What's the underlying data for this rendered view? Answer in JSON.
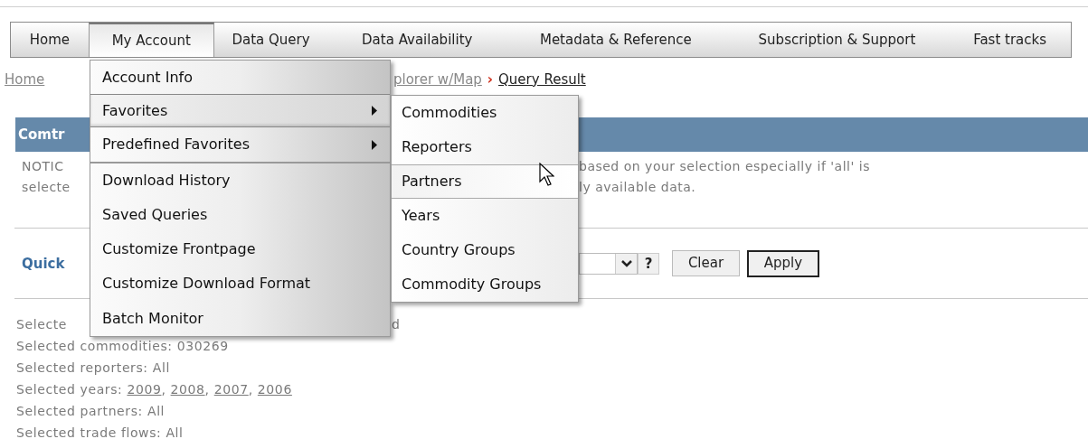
{
  "nav": [
    {
      "label": "Home",
      "selected": false
    },
    {
      "label": "My Account",
      "selected": true
    },
    {
      "label": "Data Query",
      "selected": false
    },
    {
      "label": "Data Availability",
      "selected": false
    },
    {
      "label": "Metadata & Reference",
      "selected": false
    },
    {
      "label": "Subscription & Support",
      "selected": false
    },
    {
      "label": "Fast tracks",
      "selected": false
    }
  ],
  "breadcrumb": [
    {
      "kind": "link",
      "text": "Home"
    },
    {
      "kind": "link",
      "text": "plorer w/Map"
    },
    {
      "kind": "separator",
      "text": "›"
    },
    {
      "kind": "link",
      "text": "Query Result"
    }
  ],
  "section_header": "Comtr",
  "notice": [
    {
      "left": "NOTIC",
      "right": "based on your selection especially if 'all' is"
    },
    {
      "left": "selecte",
      "right": "ly available data."
    }
  ],
  "quick_filter": {
    "label": "Quick",
    "help": "?",
    "buttons": [
      {
        "label": "Clear",
        "default": false
      },
      {
        "label": "Apply",
        "default": true
      }
    ]
  },
  "selections_first": [
    "Selecte",
    "d"
  ],
  "selections": [
    [
      {
        "text": "Selected commodities: 030269"
      }
    ],
    [
      {
        "text": "Selected reporters: All"
      }
    ],
    [
      {
        "text": "Selected years: "
      },
      {
        "text": "2009",
        "link": true
      },
      {
        "text": ", "
      },
      {
        "text": "2008",
        "link": true
      },
      {
        "text": ", "
      },
      {
        "text": "2007",
        "link": true
      },
      {
        "text": ", "
      },
      {
        "text": "2006",
        "link": true
      }
    ],
    [
      {
        "text": "Selected partners: All"
      }
    ],
    [
      {
        "text": "Selected trade flows: All"
      }
    ]
  ],
  "menu": [
    {
      "label": "Account Info",
      "has_submenu": false,
      "selected": false
    },
    {
      "label": "Favorites",
      "has_submenu": true,
      "selected": true
    },
    {
      "label": "Predefined Favorites",
      "has_submenu": true,
      "selected": false
    },
    {
      "label": "Download History",
      "has_submenu": false,
      "selected": false
    },
    {
      "label": "Saved Queries",
      "has_submenu": false,
      "selected": false
    },
    {
      "label": "Customize Frontpage",
      "has_submenu": false,
      "selected": false
    },
    {
      "label": "Customize Download Format",
      "has_submenu": false,
      "selected": false
    },
    {
      "label": "Batch Monitor",
      "has_submenu": false,
      "selected": false
    }
  ],
  "submenu": [
    {
      "label": "Commodities",
      "selected": false
    },
    {
      "label": "Reporters",
      "selected": false
    },
    {
      "label": "Partners",
      "selected": true
    },
    {
      "label": "Years",
      "selected": false
    },
    {
      "label": "Country Groups",
      "selected": false
    },
    {
      "label": "Commodity Groups",
      "selected": false
    }
  ]
}
